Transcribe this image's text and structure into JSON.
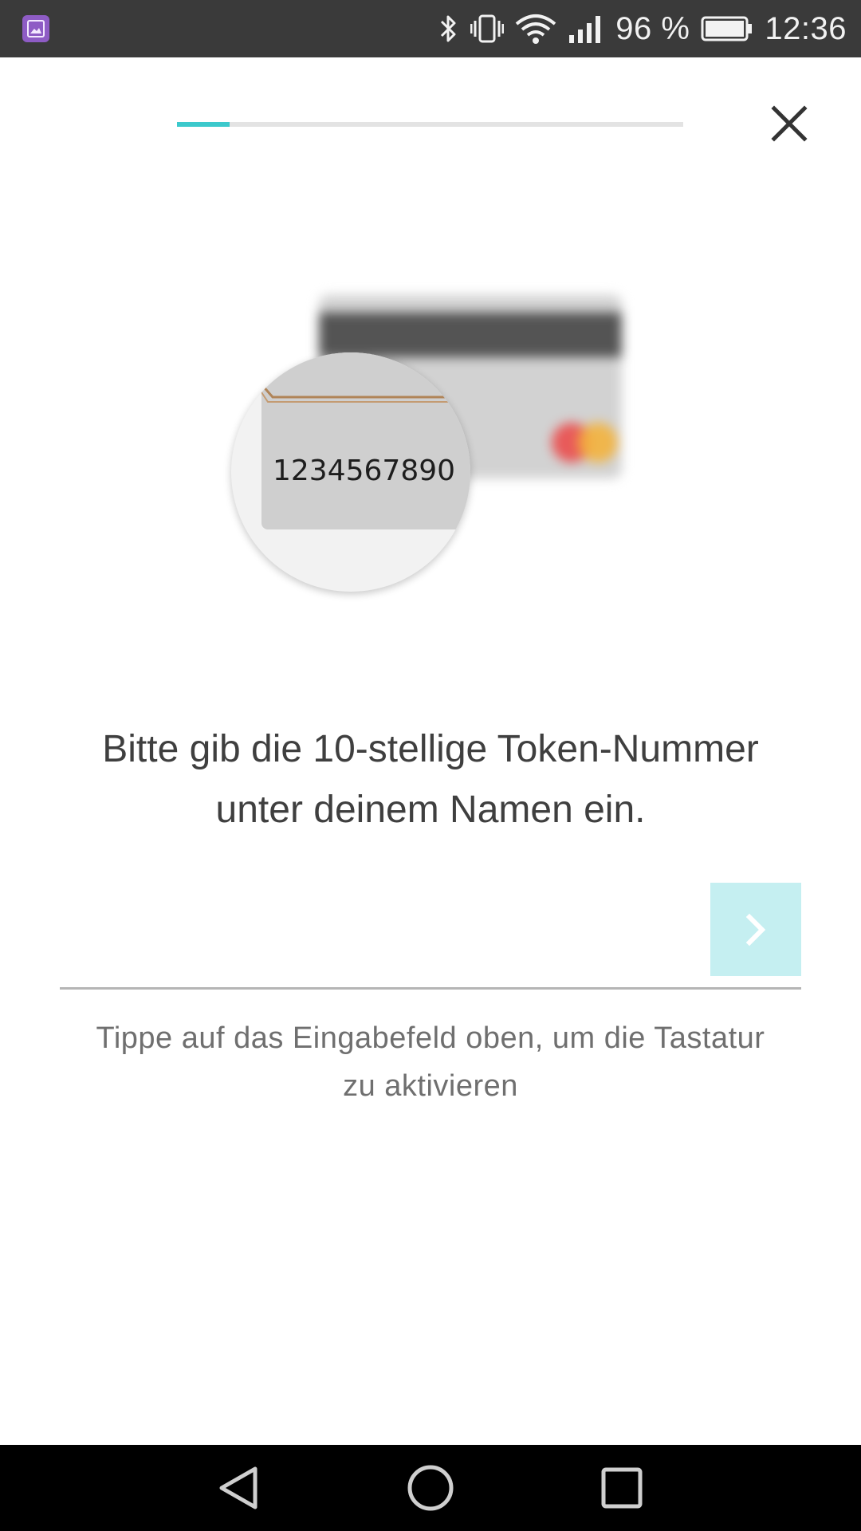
{
  "status_bar": {
    "battery_text": "96 %",
    "time": "12:36",
    "icons": [
      "gallery-app-icon",
      "bluetooth-icon",
      "vibrate-icon",
      "wifi-icon",
      "signal-icon",
      "battery-icon"
    ]
  },
  "progress": {
    "value_percent": 10.4,
    "accent_color": "#3cc9cc"
  },
  "illustration": {
    "token_sample": "1234567890"
  },
  "instruction": {
    "line1": "Bitte gib die 10-stellige Token-Nummer",
    "line2": "unter deinem Namen ein."
  },
  "input": {
    "value": "",
    "placeholder": ""
  },
  "next_button": {
    "icon": "chevron-right-icon",
    "color": "#c5eff1"
  },
  "hint": {
    "line1": "Tippe auf das Eingabefeld oben, um die Tastatur",
    "line2": "zu aktivieren"
  },
  "nav_bar": {
    "icons": [
      "back-icon",
      "home-icon",
      "recents-icon"
    ]
  }
}
